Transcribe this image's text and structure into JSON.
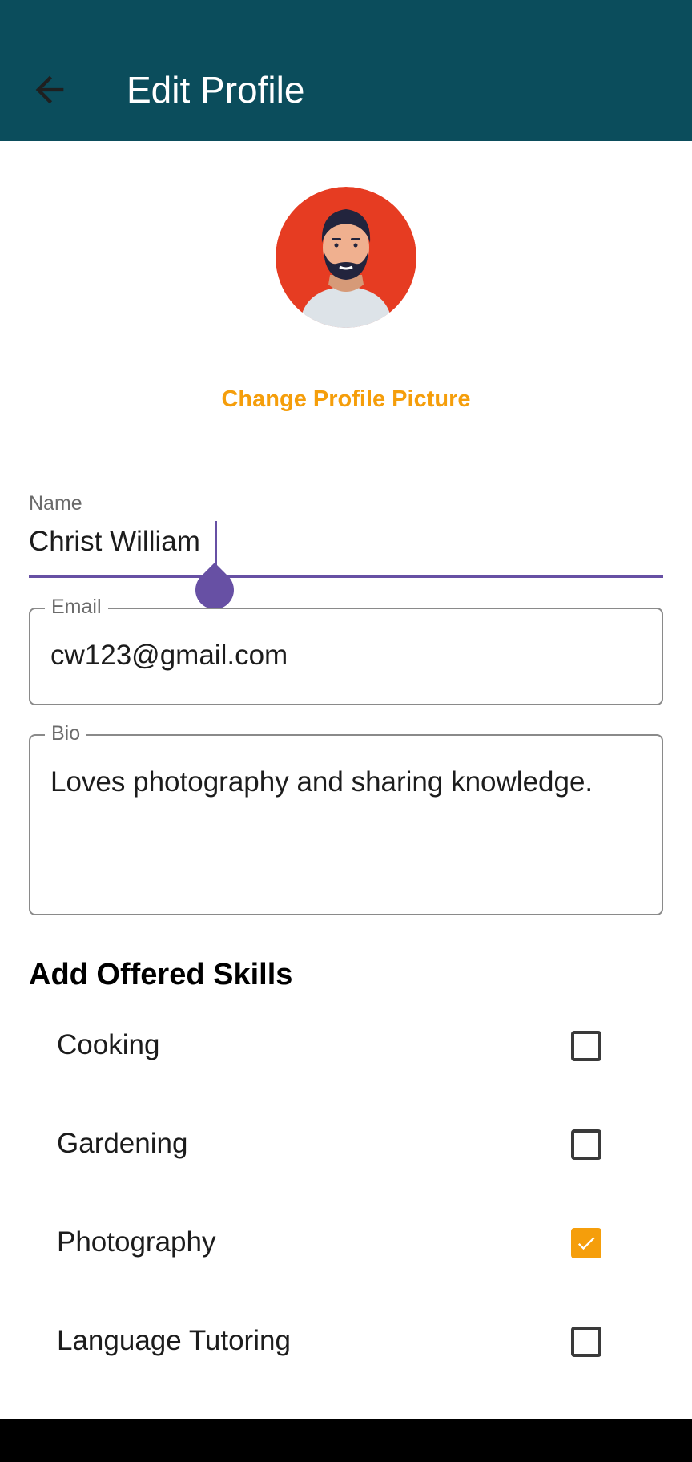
{
  "colors": {
    "appbar": "#0b4d5c",
    "accent_orange": "#f59e0b",
    "focus_purple": "#6750a4"
  },
  "appbar": {
    "back_icon": "arrow-left-icon",
    "title": "Edit Profile"
  },
  "profile": {
    "avatar_icon": "avatar-illustration",
    "change_picture_label": "Change Profile Picture"
  },
  "form": {
    "name": {
      "label": "Name",
      "value": "Christ William"
    },
    "email": {
      "label": "Email",
      "value": "cw123@gmail.com"
    },
    "bio": {
      "label": "Bio",
      "value": "Loves photography and sharing knowledge."
    }
  },
  "skills": {
    "title": "Add Offered Skills",
    "items": [
      {
        "label": "Cooking",
        "checked": false
      },
      {
        "label": "Gardening",
        "checked": false
      },
      {
        "label": "Photography",
        "checked": true
      },
      {
        "label": "Language Tutoring",
        "checked": false
      }
    ]
  }
}
